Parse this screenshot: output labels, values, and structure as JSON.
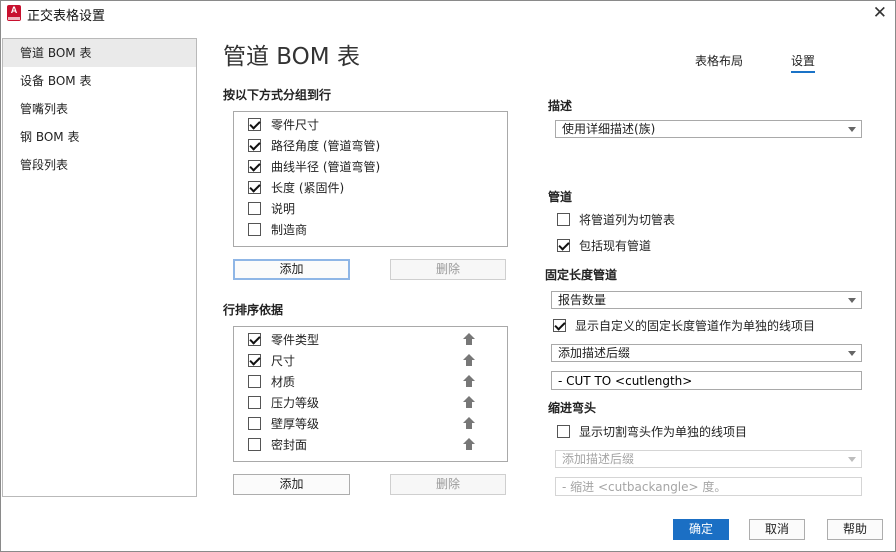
{
  "window": {
    "title": "正交表格设置",
    "app_icon_letter": "A"
  },
  "sidebar": {
    "items": [
      {
        "label": "管道 BOM 表"
      },
      {
        "label": "设备 BOM 表"
      },
      {
        "label": "管嘴列表"
      },
      {
        "label": "钢 BOM 表"
      },
      {
        "label": "管段列表"
      }
    ]
  },
  "header": {
    "page_title": "管道 BOM 表",
    "tabs": [
      {
        "label": "表格布局"
      },
      {
        "label": "设置"
      }
    ]
  },
  "grouping": {
    "label": "按以下方式分组到行",
    "items": [
      {
        "label": "零件尺寸",
        "checked": true
      },
      {
        "label": "路径角度 (管道弯管)",
        "checked": true
      },
      {
        "label": "曲线半径 (管道弯管)",
        "checked": true
      },
      {
        "label": "长度 (紧固件)",
        "checked": true
      },
      {
        "label": "说明",
        "checked": false
      },
      {
        "label": "制造商",
        "checked": false
      }
    ],
    "add_label": "添加",
    "delete_label": "删除"
  },
  "sorting": {
    "label": "行排序依据",
    "items": [
      {
        "label": "零件类型",
        "checked": true
      },
      {
        "label": "尺寸",
        "checked": true
      },
      {
        "label": "材质",
        "checked": false
      },
      {
        "label": "压力等级",
        "checked": false
      },
      {
        "label": "壁厚等级",
        "checked": false
      },
      {
        "label": "密封面",
        "checked": false
      }
    ],
    "add_label": "添加",
    "delete_label": "删除"
  },
  "description": {
    "label": "描述",
    "select_value": "使用详细描述(族)"
  },
  "pipe": {
    "label": "管道",
    "list_as_cut": {
      "label": "将管道列为切管表",
      "checked": false
    },
    "include_existing": {
      "label": "包括现有管道",
      "checked": true
    }
  },
  "fixed_length": {
    "label": "固定长度管道",
    "select_value": "报告数量",
    "show_custom": {
      "label": "显示自定义的固定长度管道作为单独的线项目",
      "checked": true
    },
    "suffix_select": "添加描述后缀",
    "suffix_text": "- CUT TO <cutlength>"
  },
  "cutback": {
    "label": "缩进弯头",
    "show_cut": {
      "label": "显示切割弯头作为单独的线项目",
      "checked": false
    },
    "suffix_select": "添加描述后缀",
    "suffix_text": "- 缩进 <cutbackangle> 度。"
  },
  "footer": {
    "ok": "确定",
    "cancel": "取消",
    "help": "帮助"
  }
}
